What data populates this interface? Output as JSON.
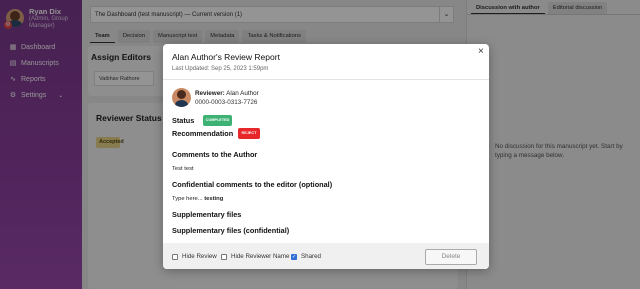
{
  "sidebar": {
    "user": {
      "name": "Ryan Dix",
      "role": "(Admin, Group Manager)"
    },
    "items": [
      {
        "label": "Dashboard",
        "icon": "grid-icon"
      },
      {
        "label": "Manuscripts",
        "icon": "document-icon"
      },
      {
        "label": "Reports",
        "icon": "chart-icon"
      },
      {
        "label": "Settings",
        "icon": "gear-icon"
      }
    ]
  },
  "main": {
    "version": "The Dashboard (test manuscript) — Current version (1)",
    "tabs": [
      "Team",
      "Decision",
      "Manuscript text",
      "Metadata",
      "Tasks & Notifications"
    ],
    "assign_title": "Assign Editors",
    "assignee": "Vaibhav Rathore",
    "reviewer_status_title": "Reviewer Status",
    "accepted_label": "Accepted"
  },
  "right_panel": {
    "tabs": [
      "Discussion with author",
      "Editorial discussion"
    ],
    "empty_message": "No discussion for this manuscript yet. Start by typing a message below."
  },
  "modal": {
    "title": "Alan Author's Review Report",
    "last_updated": "Last Updated: Sep 25, 2023 1:59pm",
    "reviewer_label": "Reviewer:",
    "reviewer_name": "Alan Author",
    "orcid": "0000-0003-0313-7726",
    "status_label": "Status",
    "status_badge": "COMPLETED",
    "recommendation_label": "Recommendation",
    "recommendation_badge": "REJECT",
    "comments_label": "Comments to the Author",
    "comments_text": "Test test",
    "confidential_label": "Confidential comments to the editor (optional)",
    "confidential_prefix": "Type here...",
    "confidential_text": "testing",
    "supplementary_label": "Supplementary files",
    "supplementary_conf_label": "Supplementary files (confidential)",
    "hide_review": "Hide Review",
    "hide_reviewer_name": "Hide Reviewer Name",
    "shared": "Shared",
    "delete_button": "Delete"
  },
  "colors": {
    "sidebar": "#8d3fa0",
    "completed": "#3eb174",
    "reject": "#e8272b",
    "checkbox": "#2f6fd6"
  }
}
